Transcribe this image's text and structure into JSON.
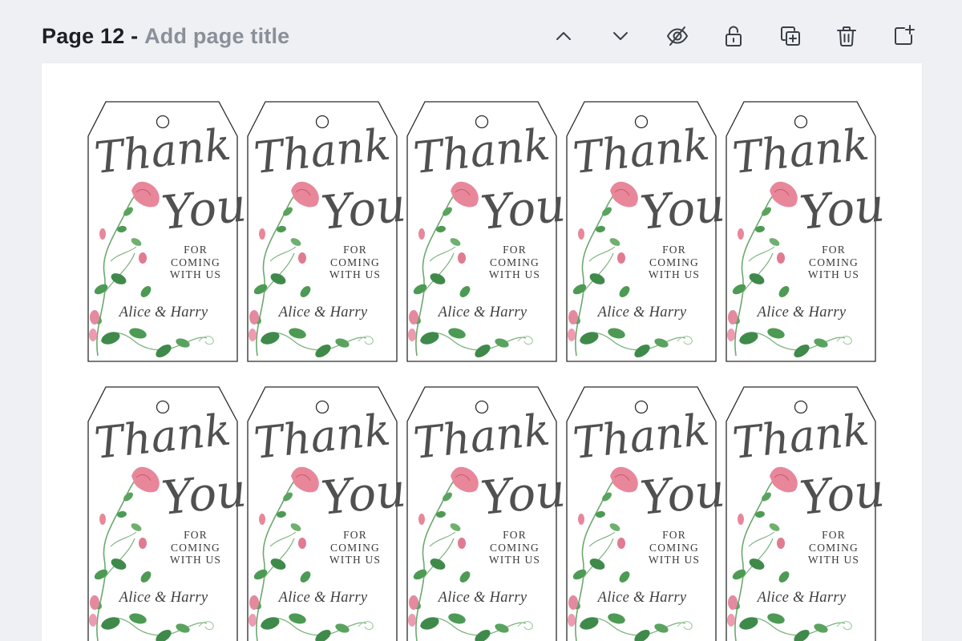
{
  "header": {
    "page_label": "Page 12 -",
    "title_placeholder": "Add page title"
  },
  "toolbar": [
    {
      "name": "move-page-up-button",
      "icon": "chevron-up-icon"
    },
    {
      "name": "move-page-down-button",
      "icon": "chevron-down-icon"
    },
    {
      "name": "hide-page-button",
      "icon": "eye-slash-icon"
    },
    {
      "name": "lock-page-button",
      "icon": "lock-icon"
    },
    {
      "name": "duplicate-page-button",
      "icon": "duplicate-icon"
    },
    {
      "name": "delete-page-button",
      "icon": "trash-icon"
    },
    {
      "name": "add-page-button",
      "icon": "add-page-icon"
    }
  ],
  "tag": {
    "thank": "Thank",
    "you": "You",
    "line1": "FOR",
    "line2": "COMING",
    "line3": "WITH US",
    "names": "Alice & Harry"
  },
  "colors": {
    "background": "#eef0f4",
    "canvas": "#ffffff",
    "title": "#1d1f24",
    "placeholder": "#8b8f98",
    "flower": "#e8879a",
    "leaf": "#4d9a55"
  }
}
